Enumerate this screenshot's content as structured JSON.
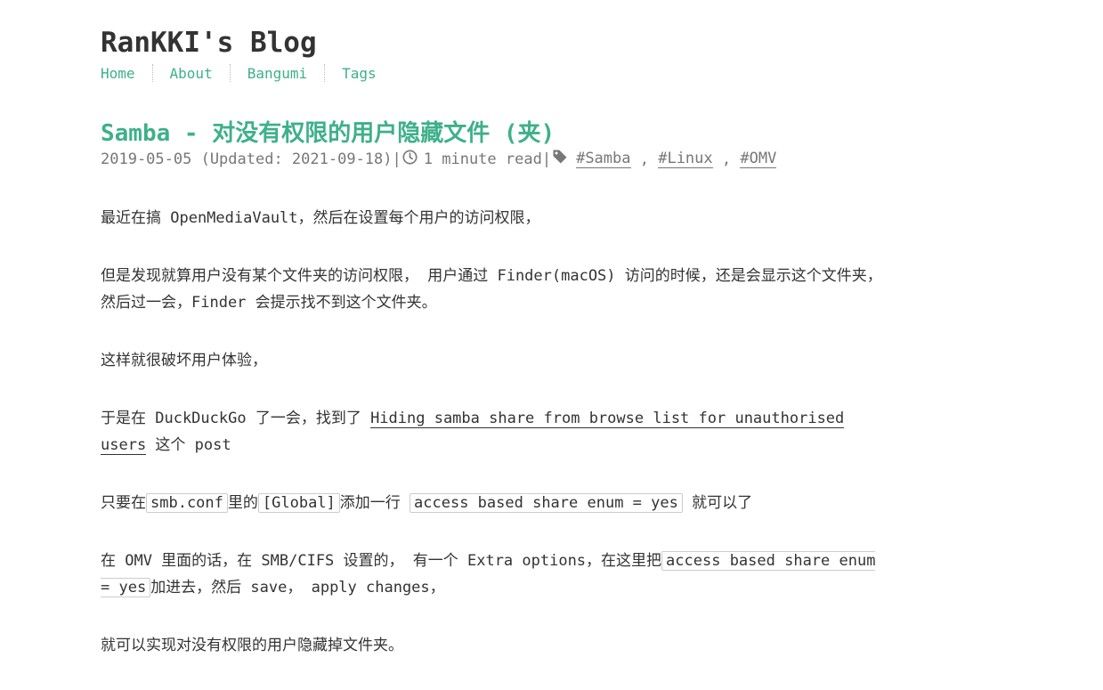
{
  "header": {
    "site_title": "RanKKI's Blog",
    "nav": [
      {
        "label": "Home"
      },
      {
        "label": "About"
      },
      {
        "label": "Bangumi"
      },
      {
        "label": "Tags"
      }
    ]
  },
  "post": {
    "title": "Samba - 对没有权限的用户隐藏文件 (夹)",
    "meta": {
      "date": "2019-05-05 (Updated: 2021-09-18)",
      "sep": "|",
      "read_time": "1 minute read",
      "tags": [
        "#Samba",
        "#Linux",
        "#OMV"
      ],
      "tag_sep": " , "
    },
    "paragraphs": {
      "p1": "最近在搞 OpenMediaVault，然后在设置每个用户的访问权限，",
      "p2": "但是发现就算用户没有某个文件夹的访问权限， 用户通过 Finder(macOS) 访问的时候，还是会显示这个文件夹，然后过一会，Finder 会提示找不到这个文件夹。",
      "p3": "这样就很破坏用户体验，",
      "p4_before": "于是在 DuckDuckGo 了一会，找到了 ",
      "p4_link": "Hiding samba share from browse list for unauthorised users",
      "p4_after": " 这个 post",
      "p5_a": "只要在",
      "p5_code1": "smb.conf",
      "p5_b": "里的",
      "p5_code2": "[Global]",
      "p5_c": "添加一行 ",
      "p5_code3": "access based share enum = yes",
      "p5_d": " 就可以了",
      "p6_a": "在 OMV 里面的话，在 SMB/CIFS 设置的， 有一个 Extra options，在这里把",
      "p6_code": "access based share enum = yes",
      "p6_b": "加进去，然后 save， apply changes，",
      "p7": "就可以实现对没有权限的用户隐藏掉文件夹。"
    }
  },
  "colors": {
    "accent": "#3eb08b",
    "text": "#333333",
    "meta": "#777777"
  },
  "icons": {
    "clock": "clock-icon",
    "tag": "tag-icon"
  }
}
